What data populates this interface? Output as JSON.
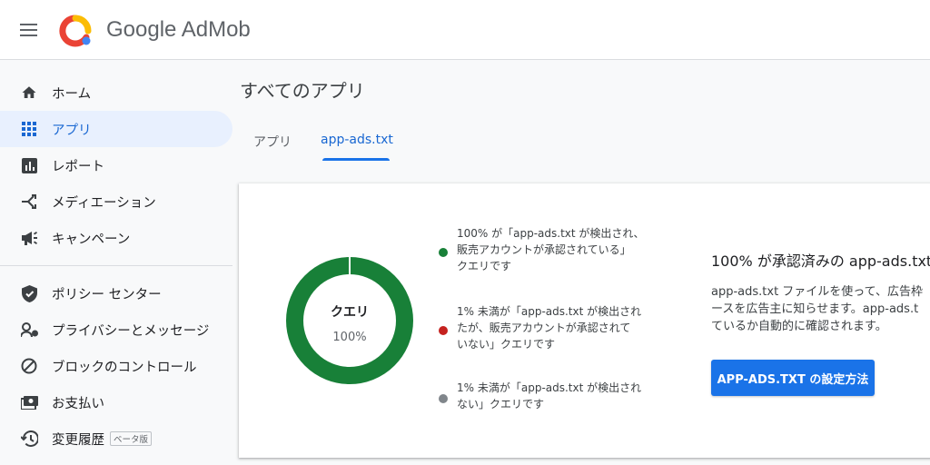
{
  "header": {
    "brand": "Google AdMob",
    "menu_icon": "hamburger-menu-icon",
    "logo_icon": "admob-logo-icon"
  },
  "sidebar": {
    "items": [
      {
        "label": "ホーム",
        "icon": "home-icon",
        "active": false
      },
      {
        "label": "アプリ",
        "icon": "apps-grid-icon",
        "active": true
      },
      {
        "label": "レポート",
        "icon": "report-icon",
        "active": false
      },
      {
        "label": "メディエーション",
        "icon": "mediation-icon",
        "active": false
      },
      {
        "label": "キャンペーン",
        "icon": "campaign-icon",
        "active": false
      },
      {
        "label": "ポリシー センター",
        "icon": "shield-icon",
        "active": false
      },
      {
        "label": "プライバシーとメッセージ",
        "icon": "privacy-icon",
        "active": false
      },
      {
        "label": "ブロックのコントロール",
        "icon": "block-icon",
        "active": false
      },
      {
        "label": "お支払い",
        "icon": "payments-icon",
        "active": false
      },
      {
        "label": "変更履歴",
        "icon": "history-icon",
        "active": false,
        "badge": "ベータ版"
      }
    ]
  },
  "main": {
    "title": "すべてのアプリ",
    "tabs": [
      {
        "label": "アプリ",
        "active": false
      },
      {
        "label": "app-ads.txt",
        "active": true
      }
    ],
    "card": {
      "donut": {
        "title": "クエリ",
        "percent_label": "100%",
        "share": 1.0,
        "color": "#188038"
      },
      "legend": [
        {
          "lines": [
            "100% が「app-ads.txt が検出され、",
            "販売アカウントが承認されている」",
            "クエリです"
          ],
          "color": "#188038"
        },
        {
          "lines": [
            "1% 未満が「app-ads.txt が検出され",
            "たが、販売アカウントが承認されて",
            "いない」クエリです"
          ],
          "color": "#c5221f"
        },
        {
          "lines": [
            "1% 未満が「app-ads.txt が検出され",
            "ない」クエリです"
          ],
          "color": "#80868b"
        }
      ],
      "info": {
        "title": "100% が承認済みの app-ads.txt",
        "body_lines": [
          "app-ads.txt ファイルを使って、広告枠",
          "ースを広告主に知らせます。app-ads.t",
          "ているか自動的に確認されます。"
        ],
        "button": "APP-ADS.TXT の設定方法"
      }
    }
  },
  "colors": {
    "accent": "#1a73e8",
    "active_nav_bg": "#e8f0fe",
    "approved": "#188038",
    "not_approved": "#c5221f",
    "not_found": "#80868b"
  }
}
